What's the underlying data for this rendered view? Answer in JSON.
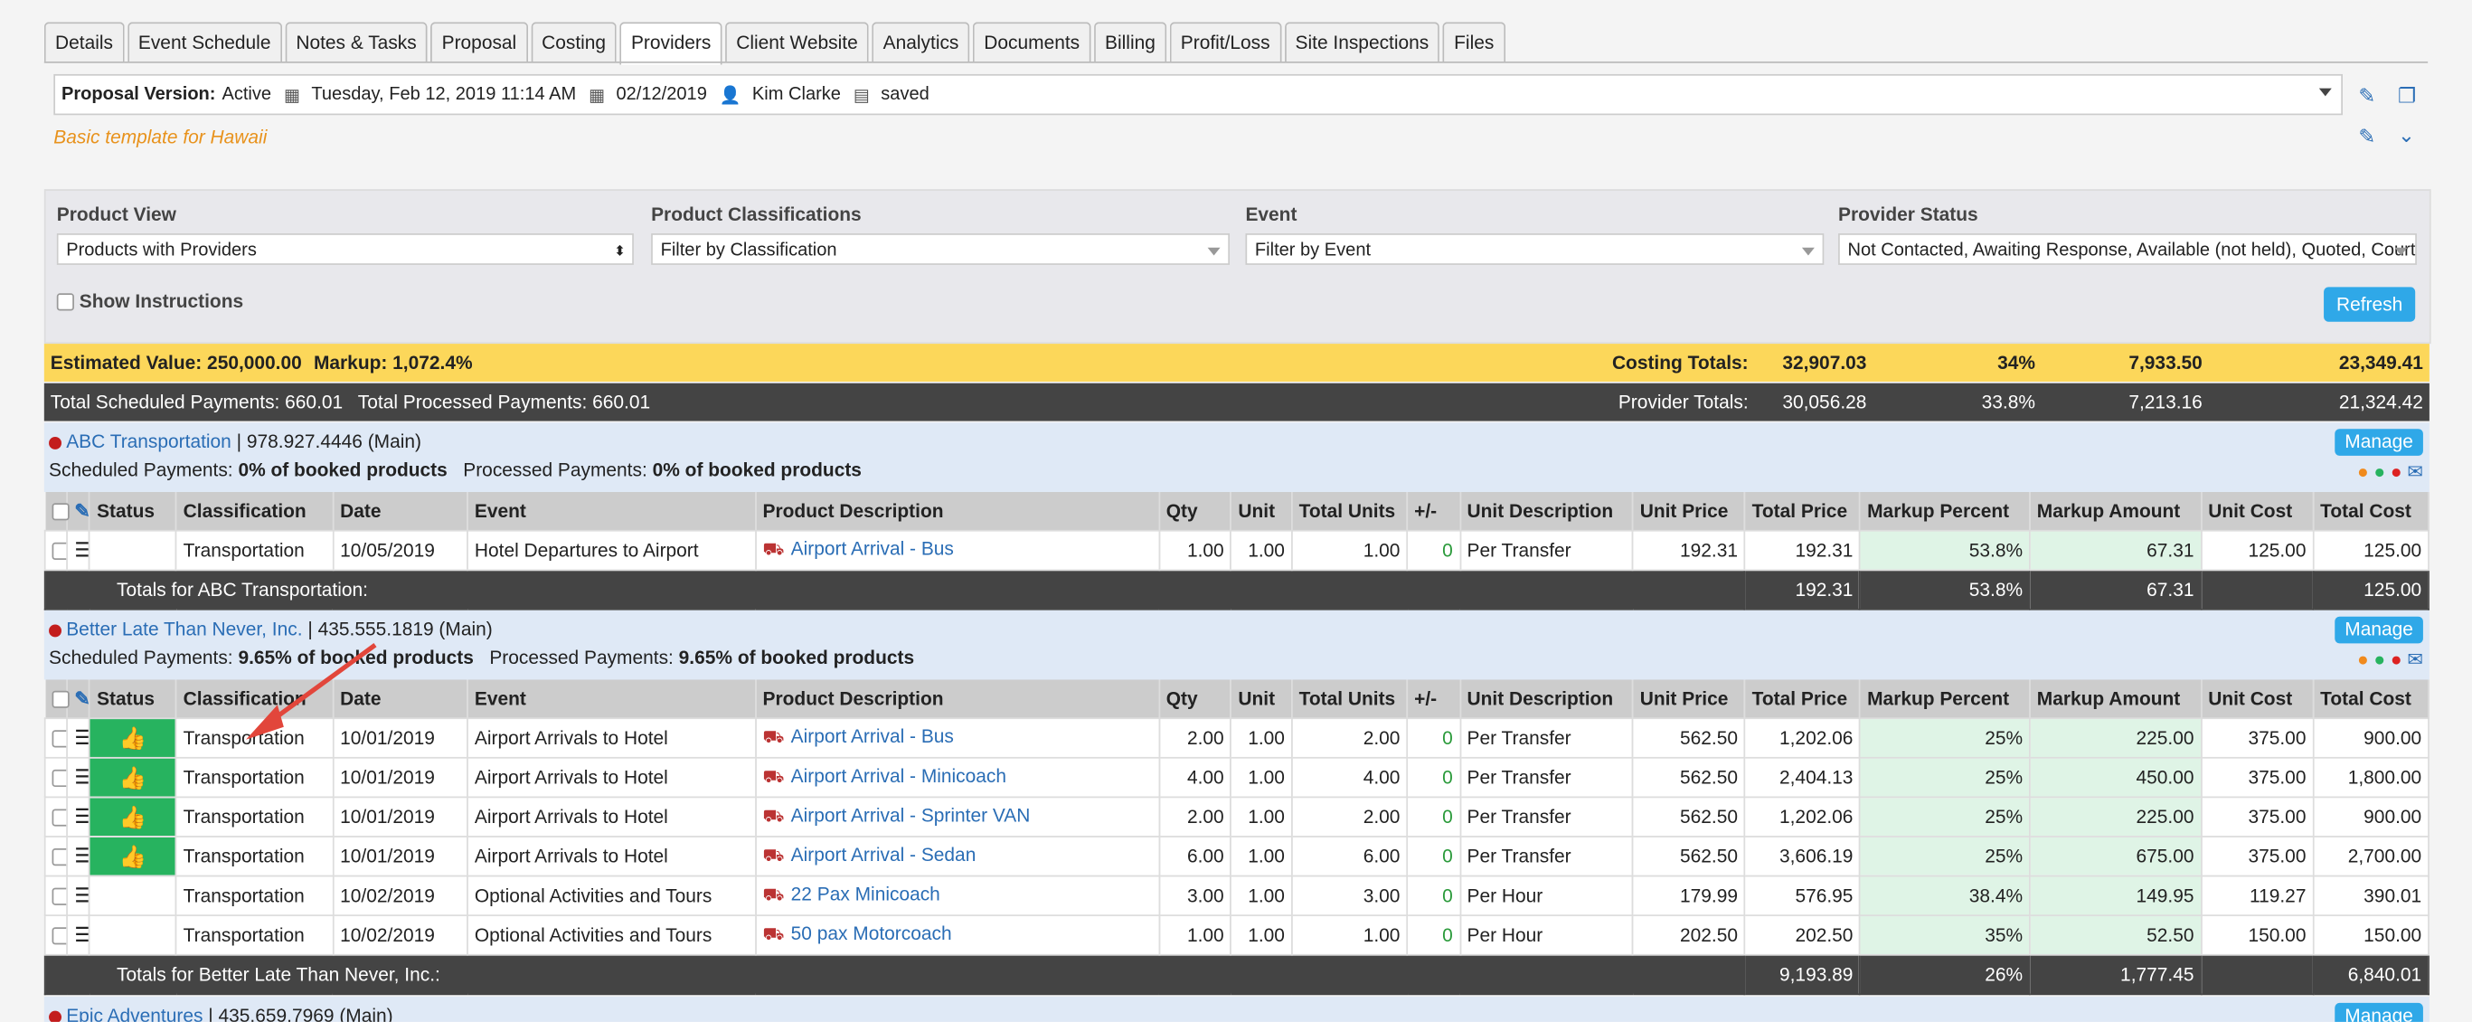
{
  "tabs": [
    "Details",
    "Event Schedule",
    "Notes & Tasks",
    "Proposal",
    "Costing",
    "Providers",
    "Client Website",
    "Analytics",
    "Documents",
    "Billing",
    "Profit/Loss",
    "Site Inspections",
    "Files"
  ],
  "active_tab": "Providers",
  "proposal": {
    "label": "Proposal Version:",
    "version": "Active",
    "datetime": "Tuesday, Feb 12, 2019 11:14 AM",
    "date": "02/12/2019",
    "user": "Kim Clarke",
    "status": "saved",
    "template": "Basic template for Hawaii"
  },
  "filters": {
    "product_view_label": "Product View",
    "product_view_value": "Products with Providers",
    "classifications_label": "Product Classifications",
    "classifications_placeholder": "Filter by Classification",
    "event_label": "Event",
    "event_placeholder": "Filter by Event",
    "provider_status_label": "Provider Status",
    "provider_status_value": "Not Contacted, Awaiting Response, Available (not held), Quoted, Courtesy",
    "show_instructions": "Show Instructions",
    "refresh": "Refresh"
  },
  "summary": {
    "estimated_value": "Estimated Value: 250,000.00",
    "markup": "Markup: 1,072.4%",
    "costing_label": "Costing Totals:",
    "costing": [
      "32,907.03",
      "34%",
      "7,933.50",
      "23,349.41"
    ],
    "scheduled": "Total Scheduled Payments: 660.01",
    "processed": "Total Processed Payments: 660.01",
    "provider_label": "Provider Totals:",
    "provider": [
      "30,056.28",
      "33.8%",
      "7,213.16",
      "21,324.42"
    ]
  },
  "columns": [
    "",
    "",
    "Status",
    "Classification",
    "Date",
    "Event",
    "Product Description",
    "Qty",
    "Unit",
    "Total Units",
    "+/-",
    "Unit Description",
    "Unit Price",
    "Total Price",
    "Markup Percent",
    "Markup Amount",
    "Unit Cost",
    "Total Cost"
  ],
  "manage": "Manage",
  "providers": [
    {
      "name": "ABC Transportation",
      "phone": "| 978.927.4446 (Main)",
      "scheduled_label": "Scheduled Payments:",
      "scheduled": "0% of booked products",
      "processed_label": "Processed Payments:",
      "processed": "0% of booked products",
      "rows": [
        {
          "classification": "Transportation",
          "date": "10/05/2019",
          "event": "Hotel Departures to Airport",
          "product": "Airport Arrival - Bus",
          "qty": "1.00",
          "unit": "1.00",
          "total_units": "1.00",
          "pm": "0",
          "unit_desc": "Per Transfer",
          "unit_price": "192.31",
          "total_price": "192.31",
          "markup_pct": "53.8%",
          "markup_amt": "67.31",
          "unit_cost": "125.00",
          "total_cost": "125.00"
        }
      ],
      "totals": {
        "label": "Totals for ABC Transportation:",
        "total_price": "192.31",
        "markup_pct": "53.8%",
        "markup_amt": "67.31",
        "total_cost": "125.00"
      }
    },
    {
      "name": "Better Late Than Never, Inc.",
      "phone": "| 435.555.1819 (Main)",
      "scheduled_label": "Scheduled Payments:",
      "scheduled": "9.65% of booked products",
      "processed_label": "Processed Payments:",
      "processed": "9.65% of booked products",
      "rows": [
        {
          "approved": true,
          "classification": "Transportation",
          "date": "10/01/2019",
          "event": "Airport Arrivals to Hotel",
          "product": "Airport Arrival - Bus",
          "qty": "2.00",
          "unit": "1.00",
          "total_units": "2.00",
          "pm": "0",
          "unit_desc": "Per Transfer",
          "unit_price": "562.50",
          "total_price": "1,202.06",
          "markup_pct": "25%",
          "markup_amt": "225.00",
          "unit_cost": "375.00",
          "total_cost": "900.00"
        },
        {
          "approved": true,
          "classification": "Transportation",
          "date": "10/01/2019",
          "event": "Airport Arrivals to Hotel",
          "product": "Airport Arrival - Minicoach",
          "qty": "4.00",
          "unit": "1.00",
          "total_units": "4.00",
          "pm": "0",
          "unit_desc": "Per Transfer",
          "unit_price": "562.50",
          "total_price": "2,404.13",
          "markup_pct": "25%",
          "markup_amt": "450.00",
          "unit_cost": "375.00",
          "total_cost": "1,800.00"
        },
        {
          "approved": true,
          "classification": "Transportation",
          "date": "10/01/2019",
          "event": "Airport Arrivals to Hotel",
          "product": "Airport Arrival - Sprinter VAN",
          "qty": "2.00",
          "unit": "1.00",
          "total_units": "2.00",
          "pm": "0",
          "unit_desc": "Per Transfer",
          "unit_price": "562.50",
          "total_price": "1,202.06",
          "markup_pct": "25%",
          "markup_amt": "225.00",
          "unit_cost": "375.00",
          "total_cost": "900.00"
        },
        {
          "approved": true,
          "classification": "Transportation",
          "date": "10/01/2019",
          "event": "Airport Arrivals to Hotel",
          "product": "Airport Arrival - Sedan",
          "qty": "6.00",
          "unit": "1.00",
          "total_units": "6.00",
          "pm": "0",
          "unit_desc": "Per Transfer",
          "unit_price": "562.50",
          "total_price": "3,606.19",
          "markup_pct": "25%",
          "markup_amt": "675.00",
          "unit_cost": "375.00",
          "total_cost": "2,700.00"
        },
        {
          "approved": false,
          "classification": "Transportation",
          "date": "10/02/2019",
          "event": "Optional Activities and Tours",
          "product": "22 Pax Minicoach",
          "qty": "3.00",
          "unit": "1.00",
          "total_units": "3.00",
          "pm": "0",
          "unit_desc": "Per Hour",
          "unit_price": "179.99",
          "total_price": "576.95",
          "markup_pct": "38.4%",
          "markup_amt": "149.95",
          "unit_cost": "119.27",
          "total_cost": "390.01"
        },
        {
          "approved": false,
          "classification": "Transportation",
          "date": "10/02/2019",
          "event": "Optional Activities and Tours",
          "product": "50 pax Motorcoach",
          "qty": "1.00",
          "unit": "1.00",
          "total_units": "1.00",
          "pm": "0",
          "unit_desc": "Per Hour",
          "unit_price": "202.50",
          "total_price": "202.50",
          "markup_pct": "35%",
          "markup_amt": "52.50",
          "unit_cost": "150.00",
          "total_cost": "150.00"
        }
      ],
      "totals": {
        "label": "Totals for Better Late Than Never, Inc.:",
        "total_price": "9,193.89",
        "markup_pct": "26%",
        "markup_amt": "1,777.45",
        "total_cost": "6,840.01"
      }
    },
    {
      "name": "Epic Adventures",
      "phone": "| 435.659.7969 (Main)"
    }
  ],
  "colors": {
    "approved": "#27b35f",
    "summary_yellow": "#fcd75a",
    "totals_dark": "#444444",
    "link": "#2a6db5",
    "markup_cell": "#dff4e6"
  }
}
